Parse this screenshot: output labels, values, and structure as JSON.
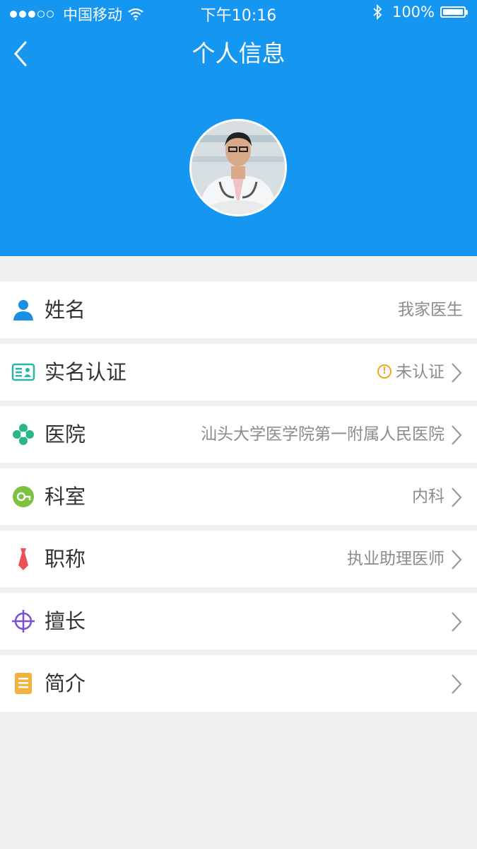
{
  "status_bar": {
    "carrier": "中国移动",
    "time": "下午10:16",
    "battery": "100%",
    "signal_bars_filled": 3,
    "signal_bars_total": 5
  },
  "nav": {
    "title": "个人信息",
    "back_icon": "chevron-left-icon"
  },
  "colors": {
    "header_bg": "#1596f0",
    "page_bg": "#f0f0f0",
    "warning": "#f0a623"
  },
  "rows": [
    {
      "label": "姓名",
      "value": "我家医生",
      "icon": "person-icon",
      "arrow": false
    },
    {
      "label": "实名认证",
      "value": "未认证",
      "icon": "id-card-icon",
      "arrow": true,
      "warning": true
    },
    {
      "label": "医院",
      "value": "汕头大学医学院第一附属人民医院",
      "icon": "hospital-icon",
      "arrow": true
    },
    {
      "label": "科室",
      "value": "内科",
      "icon": "department-icon",
      "arrow": true
    },
    {
      "label": "职称",
      "value": "执业助理医师",
      "icon": "tie-icon",
      "arrow": true
    },
    {
      "label": "擅长",
      "value": "",
      "icon": "target-icon",
      "arrow": true
    },
    {
      "label": "简介",
      "value": "",
      "icon": "document-icon",
      "arrow": true
    }
  ]
}
